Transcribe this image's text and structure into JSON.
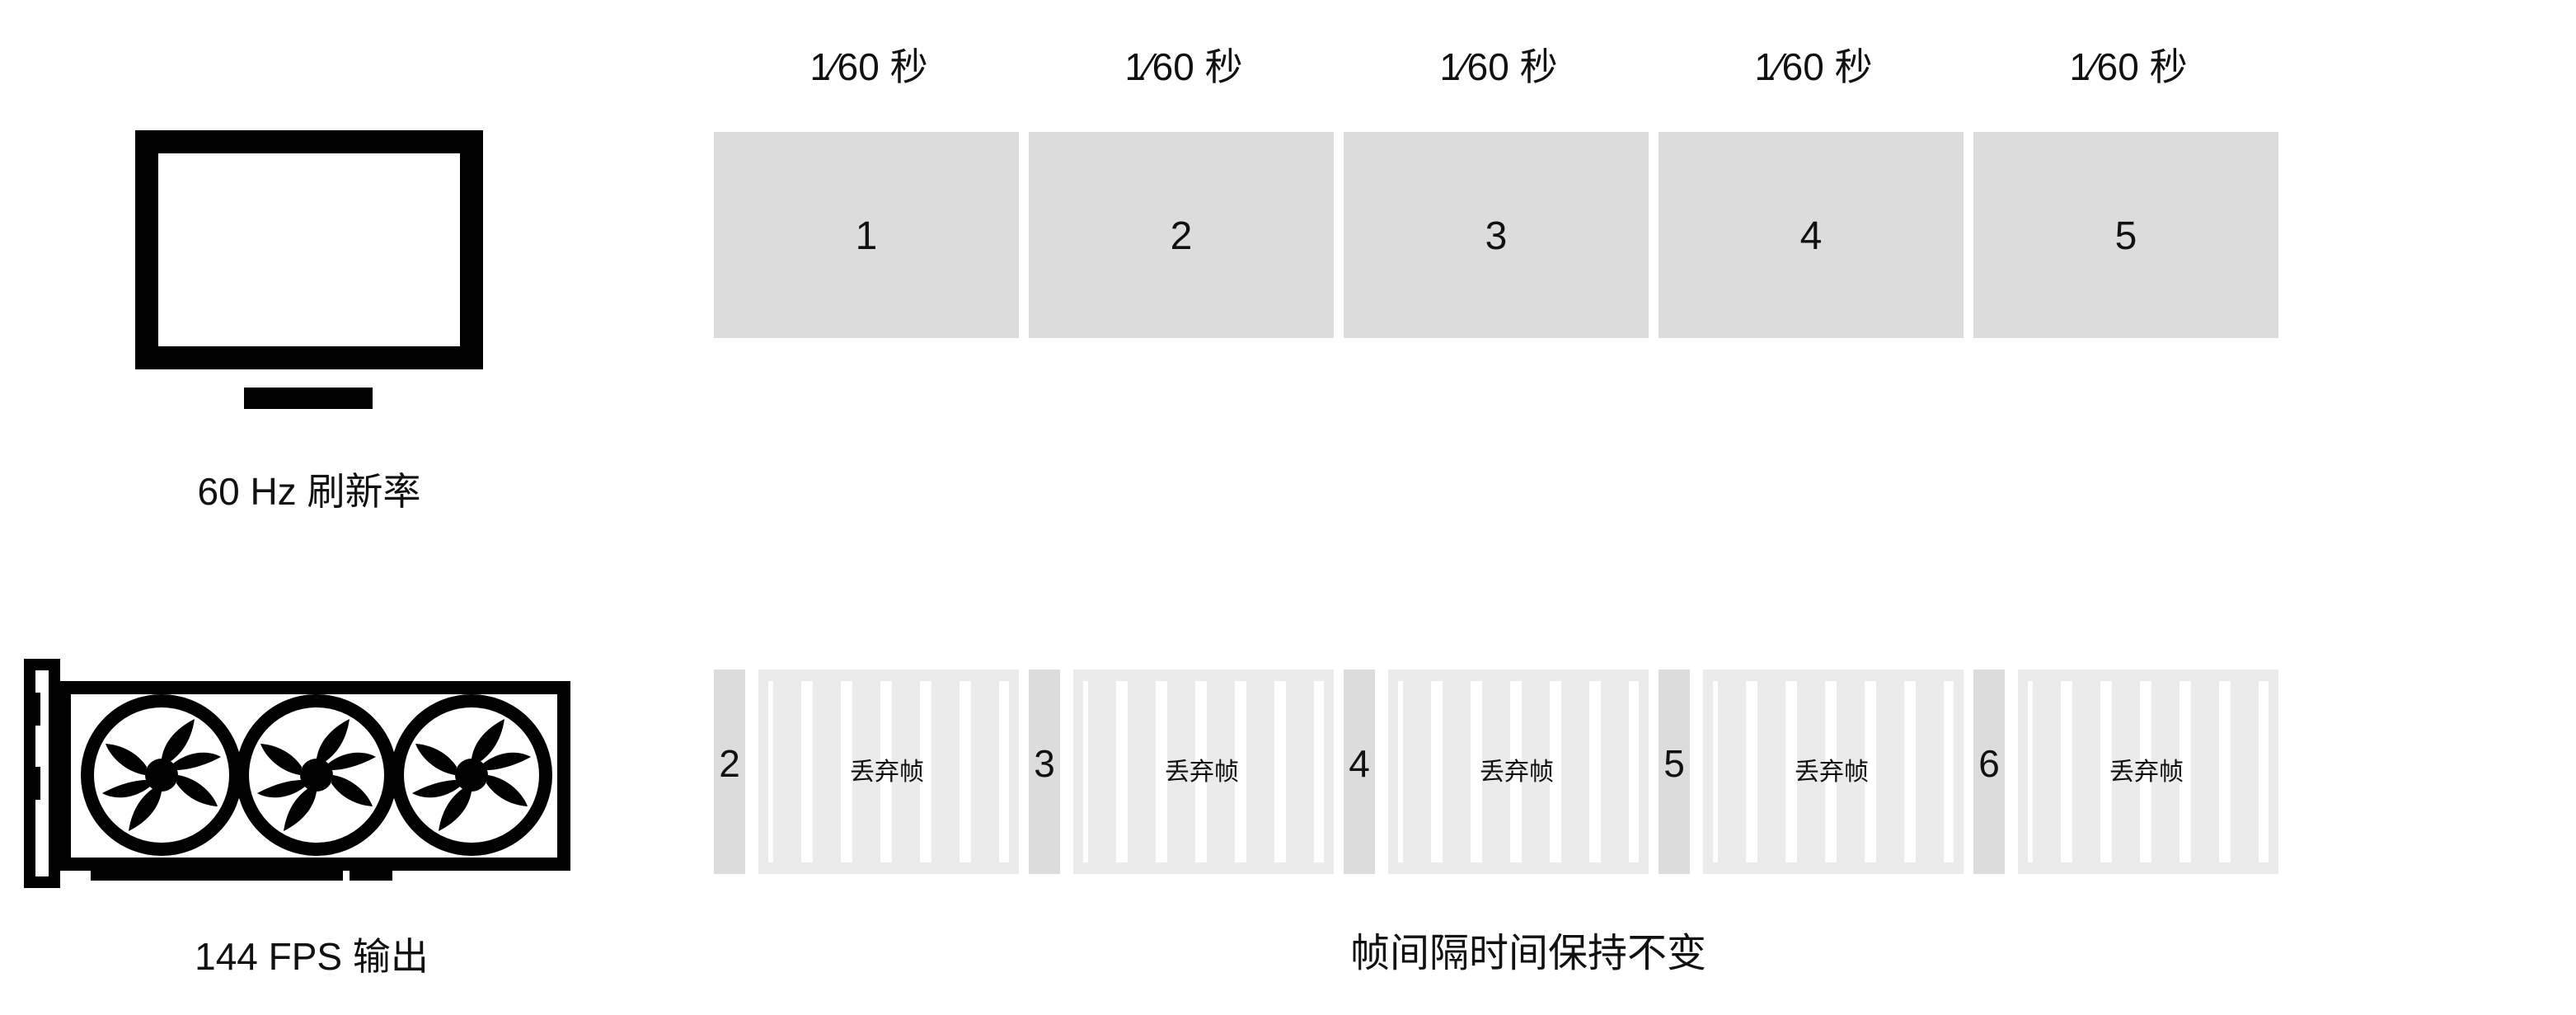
{
  "monitor": {
    "label": "60 Hz 刷新率",
    "slot_label": "1⁄60 秒",
    "frames": [
      "1",
      "2",
      "3",
      "4",
      "5"
    ]
  },
  "gpu": {
    "label": "144 FPS 输出",
    "groups": [
      {
        "shown": "2",
        "dropped": "丢弃帧"
      },
      {
        "shown": "3",
        "dropped": "丢弃帧"
      },
      {
        "shown": "4",
        "dropped": "丢弃帧"
      },
      {
        "shown": "5",
        "dropped": "丢弃帧"
      },
      {
        "shown": "6",
        "dropped": "丢弃帧"
      }
    ]
  },
  "caption": "帧间隔时间保持不变",
  "colors": {
    "frame_fill": "#dcdcdc",
    "dropped_fill": "#ebebeb",
    "icon": "#000000",
    "text": "#111111"
  },
  "icons": [
    "monitor-icon",
    "graphics-card-icon"
  ]
}
